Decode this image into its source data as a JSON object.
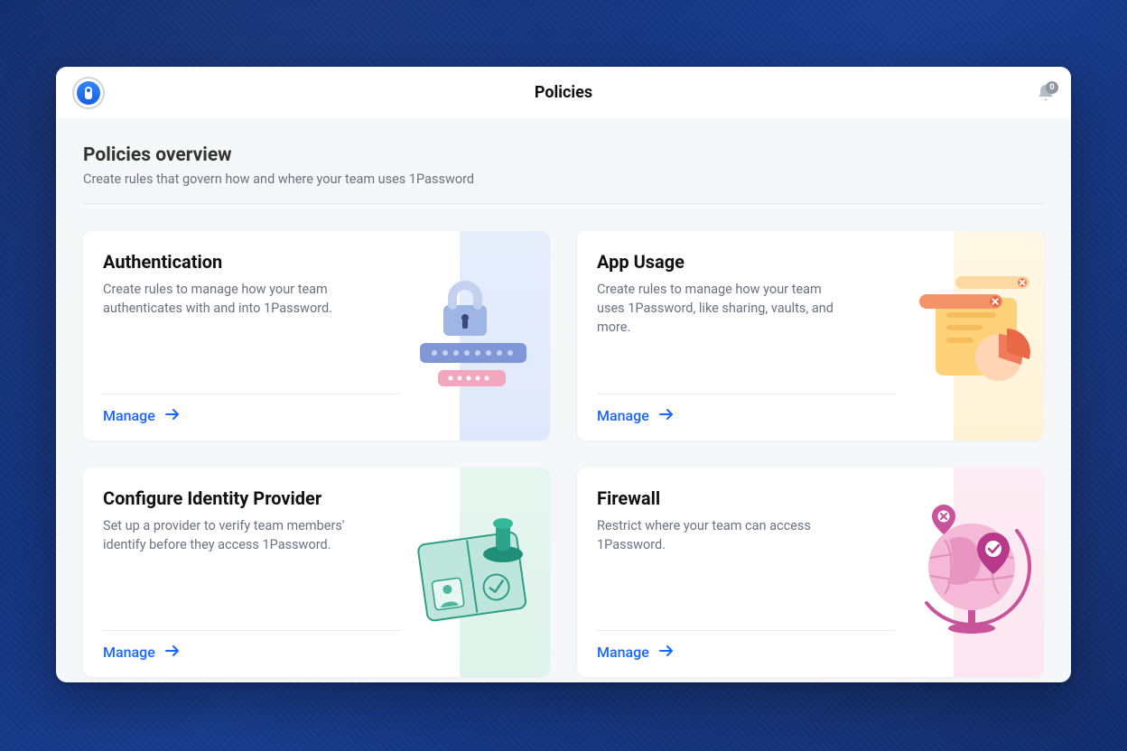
{
  "header": {
    "title": "Policies",
    "notification_count": "0"
  },
  "overview": {
    "heading": "Policies overview",
    "subheading": "Create rules that govern how and where your team uses 1Password"
  },
  "cards": [
    {
      "title": "Authentication",
      "description": "Create rules to manage how your team authenticates with and into 1Password.",
      "action": "Manage"
    },
    {
      "title": "App Usage",
      "description": "Create rules to manage how your team uses 1Password, like sharing, vaults, and more.",
      "action": "Manage"
    },
    {
      "title": "Configure Identity Provider",
      "description": "Set up a provider to verify team members' identify before they access 1Password.",
      "action": "Manage"
    },
    {
      "title": "Firewall",
      "description": "Restrict where your team can access 1Password.",
      "action": "Manage"
    }
  ]
}
